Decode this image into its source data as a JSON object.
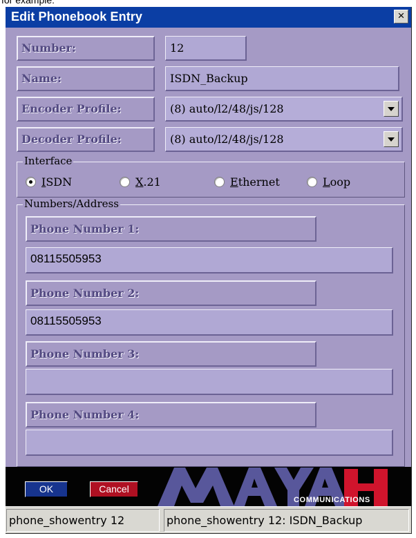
{
  "crop_text": "for example:",
  "window": {
    "title": "Edit Phonebook Entry",
    "close_label": "×"
  },
  "fields": {
    "number_label": "Number:",
    "number_value": "12",
    "name_label": "Name:",
    "name_value": "ISDN_Backup",
    "encoder_label": "Encoder Profile:",
    "encoder_value": "(8) auto/l2/48/js/128",
    "decoder_label": "Decoder Profile:",
    "decoder_value": "(8) auto/l2/48/js/128"
  },
  "interface": {
    "legend": "Interface",
    "selected": "ISDN",
    "options": [
      {
        "label": "ISDN",
        "mnemonic": "I",
        "rest": "SDN"
      },
      {
        "label": "X.21",
        "mnemonic": "X",
        "rest": ".21"
      },
      {
        "label": "Ethernet",
        "mnemonic": "E",
        "rest": "thernet"
      },
      {
        "label": "Loop",
        "mnemonic": "L",
        "rest": "oop"
      }
    ]
  },
  "numbers_address": {
    "legend": "Numbers/Address",
    "items": [
      {
        "label": "Phone Number 1:",
        "value": "08115505953"
      },
      {
        "label": "Phone Number 2:",
        "value": "08115505953"
      },
      {
        "label": "Phone Number 3:",
        "value": ""
      },
      {
        "label": "Phone Number 4:",
        "value": ""
      }
    ]
  },
  "actions": {
    "ok_label": "OK",
    "cancel_label": "Cancel"
  },
  "logo": {
    "wordmark": "MAYAH",
    "tagline": "COMMUNICATIONS"
  },
  "status": {
    "left": "phone_showentry 12",
    "right": "phone_showentry 12: ISDN_Backup"
  },
  "colors": {
    "title_bar": "#0b3ea4",
    "dialog_background": "#a59ac5",
    "field_background": "#b0a8d4",
    "ok_button": "#17348e",
    "cancel_button": "#af1022",
    "status_bar": "#d9d8d2"
  },
  "icons": {
    "close": "close-icon",
    "dropdown": "chevron-down-icon",
    "radio": "radio-button-icon"
  }
}
